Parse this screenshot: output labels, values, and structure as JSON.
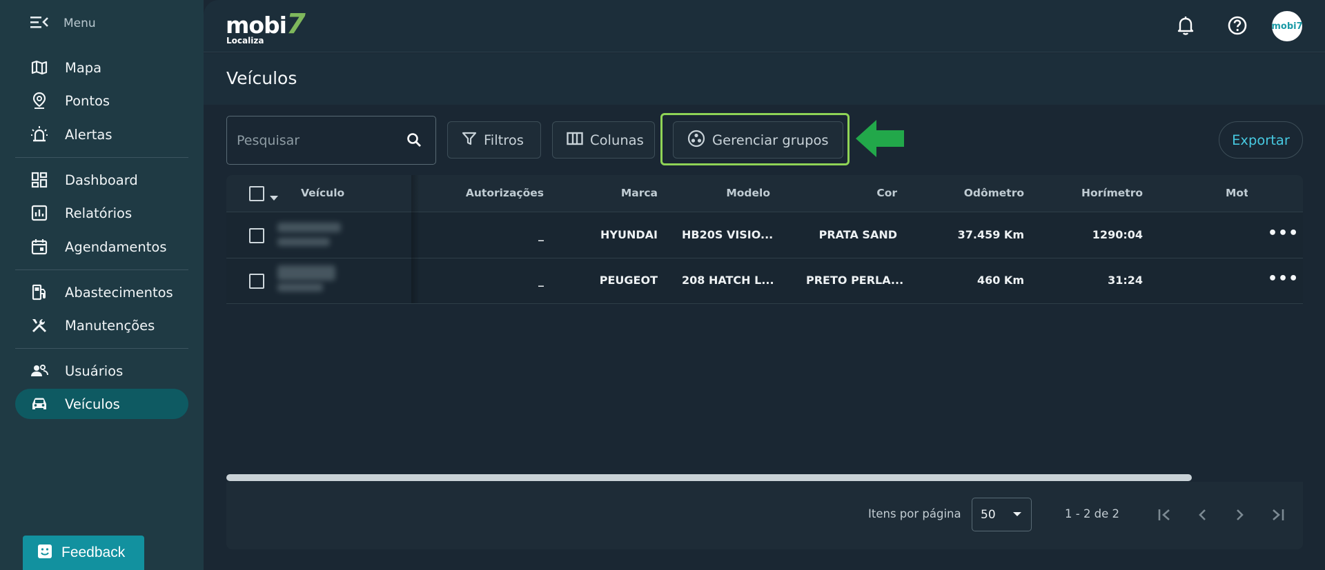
{
  "sidebar": {
    "menu_label": "Menu",
    "items": [
      {
        "label": "Mapa",
        "icon": "map-icon"
      },
      {
        "label": "Pontos",
        "icon": "location-pin-icon"
      },
      {
        "label": "Alertas",
        "icon": "alarm-light-icon"
      },
      {
        "label": "Dashboard",
        "icon": "dashboard-icon"
      },
      {
        "label": "Relatórios",
        "icon": "report-chart-icon"
      },
      {
        "label": "Agendamentos",
        "icon": "calendar-icon"
      },
      {
        "label": "Abastecimentos",
        "icon": "fuel-pump-icon"
      },
      {
        "label": "Manutenções",
        "icon": "tools-icon"
      },
      {
        "label": "Usuários",
        "icon": "users-icon"
      },
      {
        "label": "Veículos",
        "icon": "car-icon",
        "active": true
      }
    ],
    "feedback_label": "Feedback"
  },
  "topbar": {
    "logo_text": "mobi",
    "logo_seven": "7",
    "logo_sub": "Localiza",
    "avatar_text": "mobi7",
    "icons": [
      "bell-icon",
      "help-circle-icon"
    ]
  },
  "page": {
    "title": "Veículos"
  },
  "toolbar": {
    "search_placeholder": "Pesquisar",
    "filters_label": "Filtros",
    "columns_label": "Colunas",
    "groups_label": "Gerenciar grupos",
    "export_label": "Exportar"
  },
  "table": {
    "columns": [
      "Veículo",
      "Autorizações",
      "Marca",
      "Modelo",
      "Cor",
      "Odômetro",
      "Horímetro",
      "Moto"
    ],
    "rows": [
      {
        "autorizacoes": "_",
        "marca": "HYUNDAI",
        "modelo": "HB20S VISIO...",
        "cor": "PRATA SAND",
        "odometro": "37.459 Km",
        "horimetro": "1290:04"
      },
      {
        "autorizacoes": "_",
        "marca": "PEUGEOT",
        "modelo": "208 HATCH L...",
        "cor": "PRETO PERLA...",
        "odometro": "460 Km",
        "horimetro": "31:24"
      }
    ],
    "row_menu": "•••"
  },
  "pagination": {
    "items_per_page_label": "Itens por página",
    "items_per_page_value": "50",
    "range_text": "1 - 2 de 2"
  },
  "colors": {
    "sidebar_bg": "#1f3a44",
    "active_bg": "#0e5a62",
    "accent": "#47c8e0",
    "highlight_border": "#8fd456",
    "arrow_green": "#22a84a",
    "feedback_bg": "#12919f"
  }
}
